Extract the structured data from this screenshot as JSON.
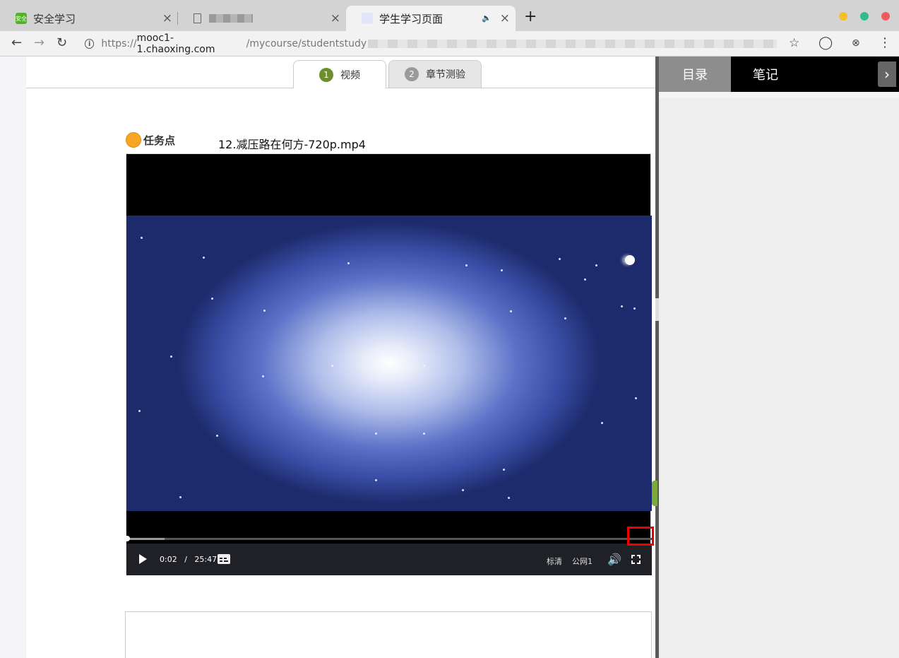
{
  "browser": {
    "tabs": [
      {
        "title": "安全学习",
        "favicon_text": "安全"
      },
      {
        "title": ""
      },
      {
        "title": "学生学习页面",
        "audio": "🔈"
      }
    ],
    "close_glyph": "×",
    "new_tab_glyph": "+",
    "window_buttons": [
      "#f5bf2a",
      "#2dbd8e",
      "#f05a5a"
    ],
    "address": {
      "scheme": "https://",
      "host": "mooc1-1.chaoxing.com",
      "path": "/mycourse/studentstudy"
    }
  },
  "content_tabs": [
    {
      "number": "1",
      "label": "视频",
      "active": true
    },
    {
      "number": "2",
      "label": "章节测验",
      "active": false
    }
  ],
  "task": {
    "label": "任务点",
    "filename": "12.减压路在何方-720p.mp4"
  },
  "player": {
    "current_time": "0:02",
    "separator": "/",
    "duration": "25:47",
    "progress_fraction": 0.0013,
    "buffered_fraction": 0.073,
    "quality": "标清",
    "line": "公网1"
  },
  "right_panel": {
    "tabs": [
      "目录",
      "笔记"
    ],
    "collapse_glyph": "›"
  },
  "colors": {
    "accent_green": "#6c8f2b",
    "task_dot": "#f6a623",
    "annotation_red": "#ee0000"
  }
}
